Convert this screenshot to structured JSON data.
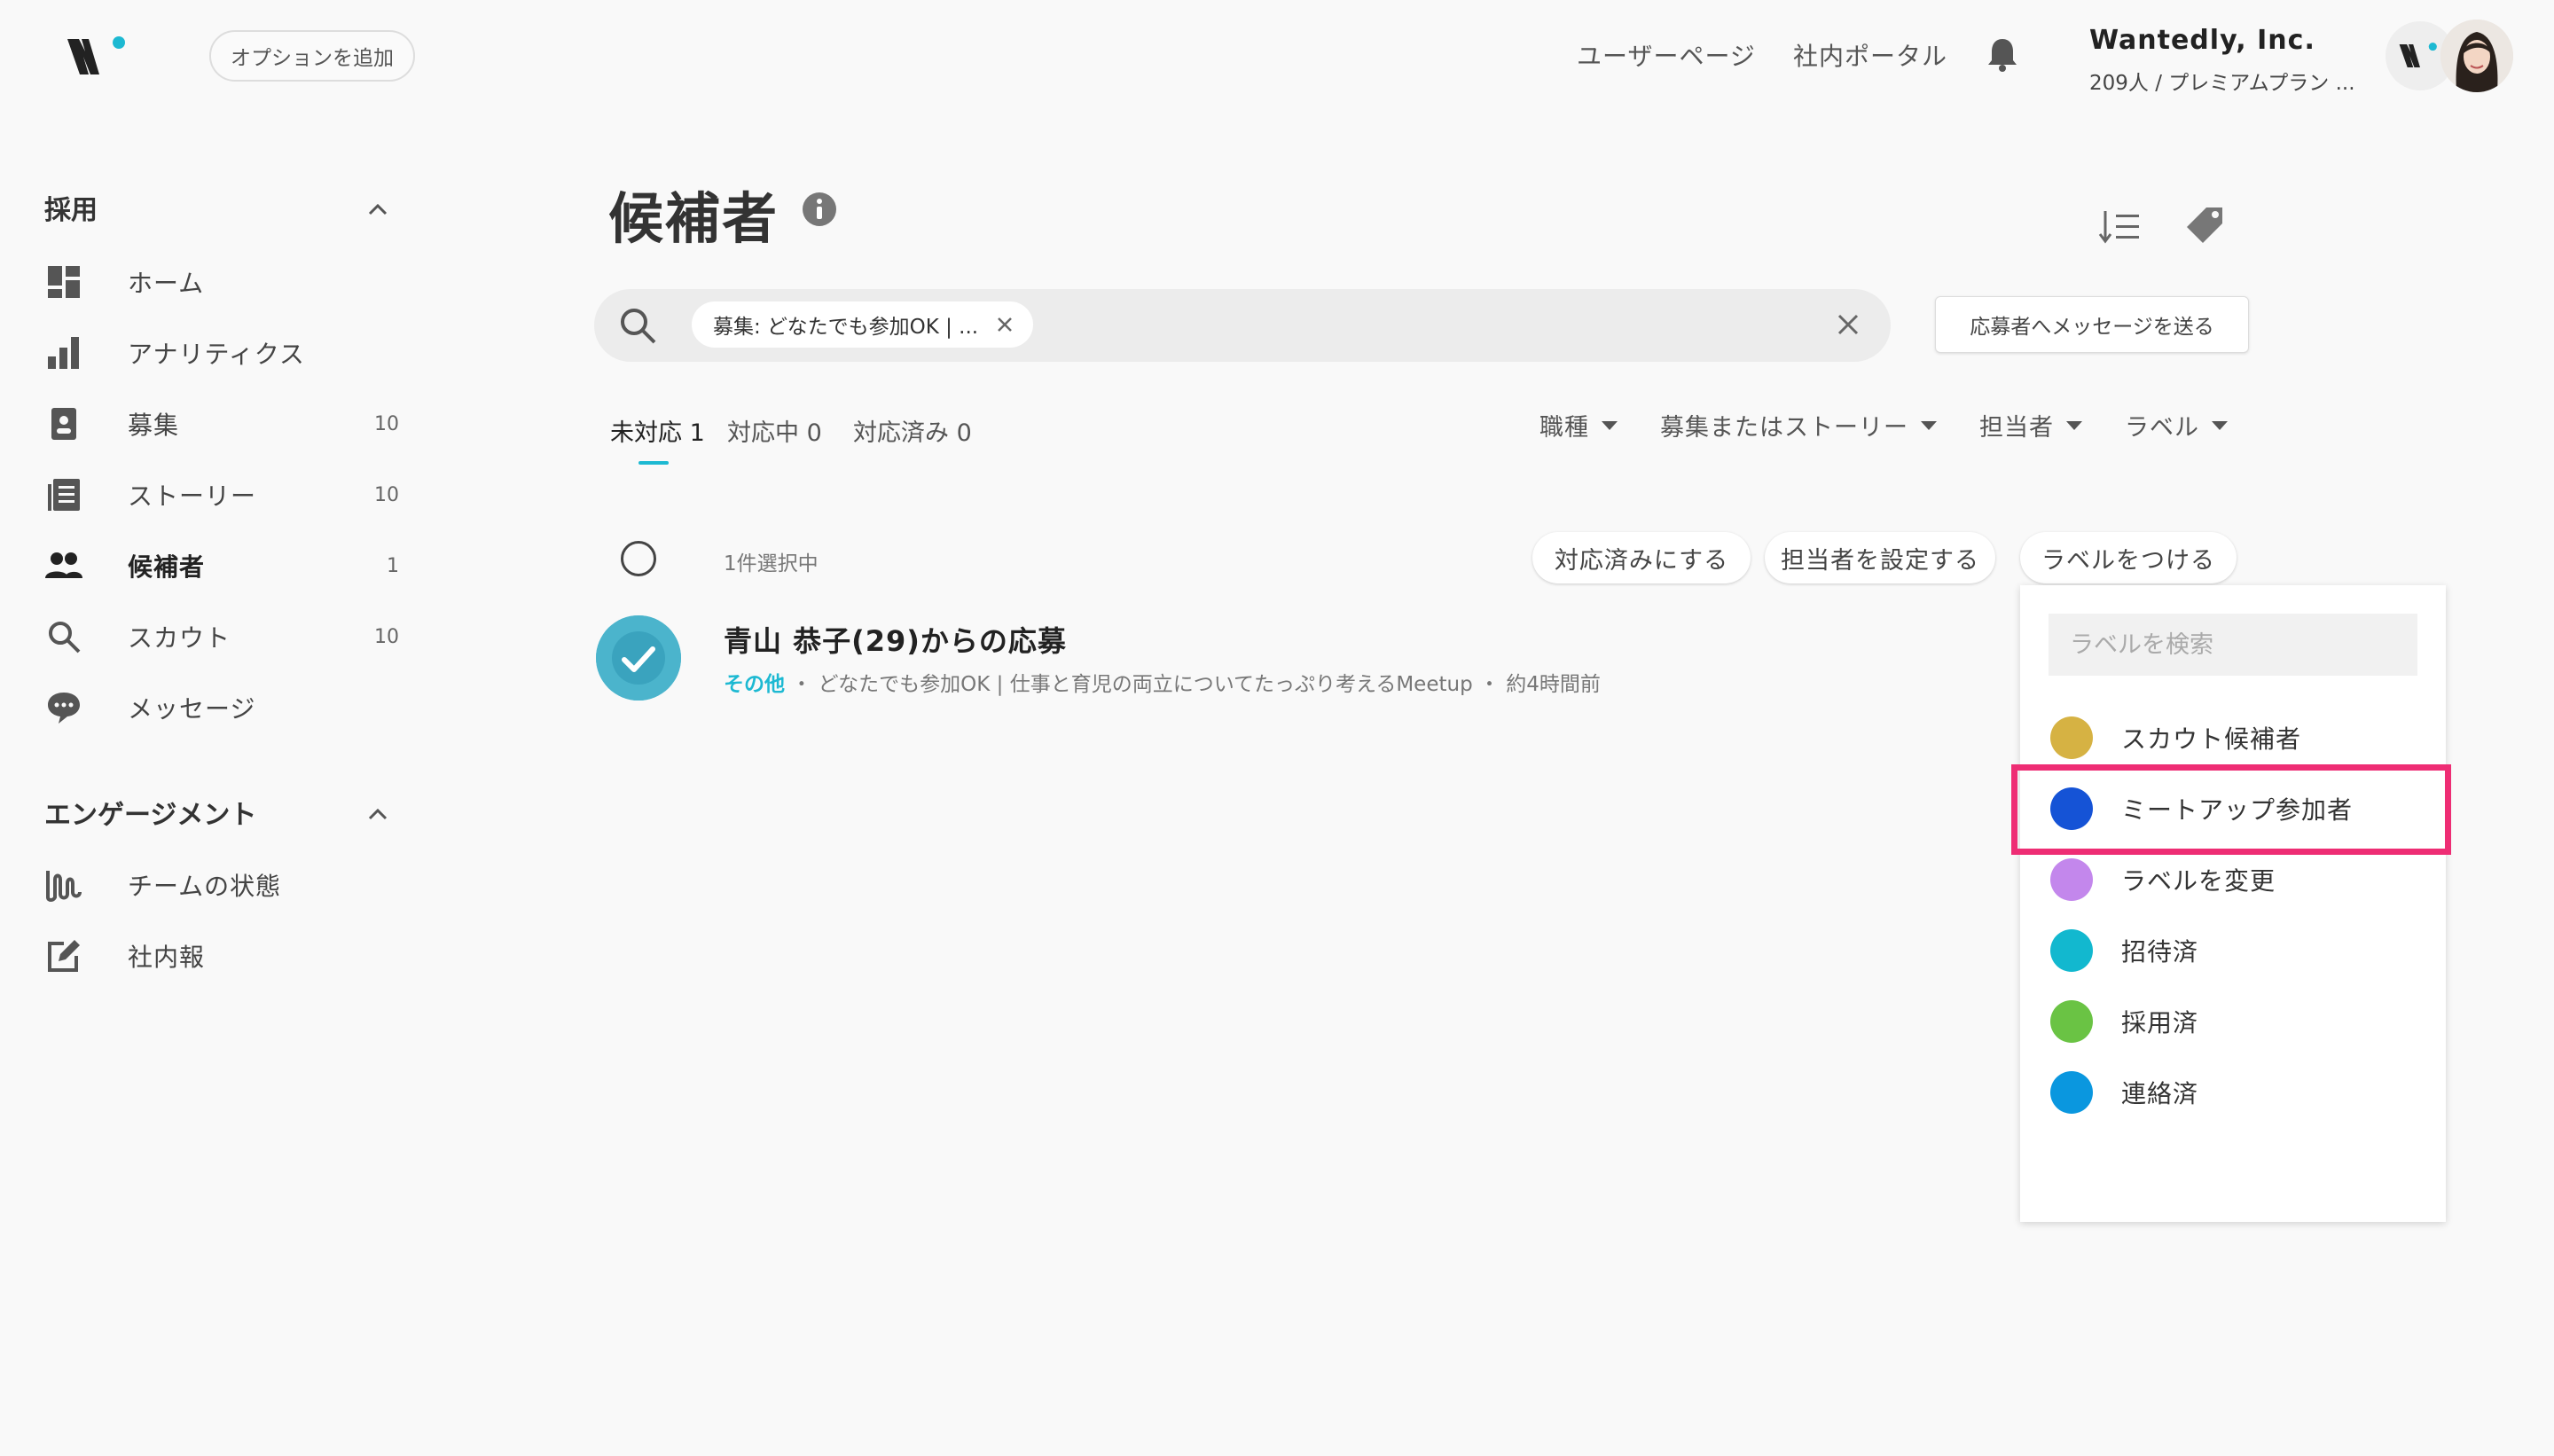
{
  "header": {
    "add_option_label": "オプションを追加",
    "user_page_label": "ユーザーページ",
    "portal_label": "社内ポータル",
    "company_name": "Wantedly, Inc.",
    "plan_text": "209人 / プレミアムプラン ...",
    "icons": [
      "wantedly-logo-icon",
      "bell-icon"
    ]
  },
  "sidebar": {
    "recruit_heading": "採用",
    "recruit_items": [
      {
        "label": "ホーム",
        "count": "",
        "icon": "dashboard-icon"
      },
      {
        "label": "アナリティクス",
        "count": "",
        "icon": "bar-chart-icon"
      },
      {
        "label": "募集",
        "count": "10",
        "icon": "job-post-icon"
      },
      {
        "label": "ストーリー",
        "count": "10",
        "icon": "story-icon"
      },
      {
        "label": "候補者",
        "count": "1",
        "icon": "people-icon"
      },
      {
        "label": "スカウト",
        "count": "10",
        "icon": "search-icon"
      },
      {
        "label": "メッセージ",
        "count": "",
        "icon": "chat-icon"
      }
    ],
    "engagement_heading": "エンゲージメント",
    "engagement_items": [
      {
        "label": "チームの状態",
        "icon": "wave-icon"
      },
      {
        "label": "社内報",
        "icon": "edit-icon"
      }
    ]
  },
  "main": {
    "title": "候補者",
    "search_chip": "募集: どなたでも参加OK | ...",
    "send_message_label": "応募者へメッセージを送る",
    "tabs": [
      {
        "label": "未対応 1"
      },
      {
        "label": "対応中 0"
      },
      {
        "label": "対応済み 0"
      }
    ],
    "filters": [
      "職種",
      "募集またはストーリー",
      "担当者",
      "ラベル"
    ],
    "selection_count": "1件選択中",
    "actions": [
      "対応済みにする",
      "担当者を設定する",
      "ラベルをつける"
    ],
    "candidate": {
      "name": "青山 恭子(29)からの応募",
      "category": "その他",
      "meta": "・ どなたでも参加OK | 仕事と育児の両立についてたっぷり考えるMeetup ・ 約4時間前"
    }
  },
  "label_dropdown": {
    "search_placeholder": "ラベルを検索",
    "items": [
      {
        "label": "スカウト候補者",
        "color": "#d6b243"
      },
      {
        "label": "ミートアップ参加者",
        "color": "#1553d6"
      },
      {
        "label": "ラベルを変更",
        "color": "#c387ec"
      },
      {
        "label": "招待済",
        "color": "#12b8cf"
      },
      {
        "label": "採用済",
        "color": "#6ac344"
      },
      {
        "label": "連絡済",
        "color": "#0a97df"
      }
    ],
    "highlight_color": "#ee2d74"
  }
}
